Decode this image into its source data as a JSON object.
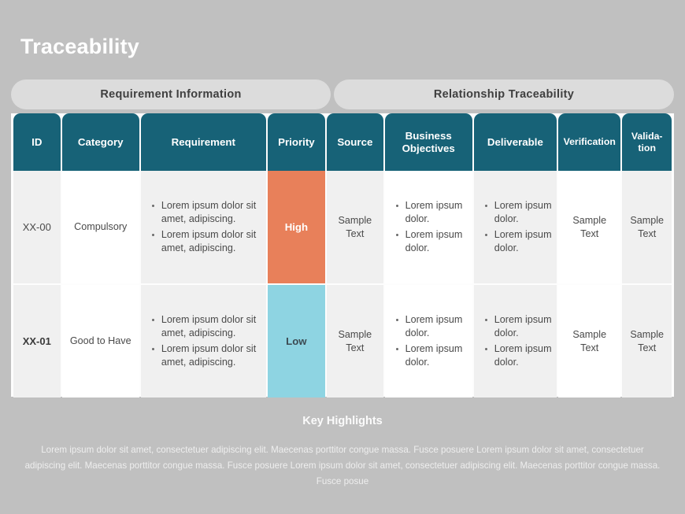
{
  "slide": {
    "title": "Traceability",
    "background_color": "#c0c0c0",
    "header_color": "#176277",
    "high_color": "#e8805a",
    "low_color": "#8ed4e2"
  },
  "banners": {
    "left": "Requirement Information",
    "right": "Relationship Traceability"
  },
  "table": {
    "columns": [
      {
        "key": "id",
        "label": "ID"
      },
      {
        "key": "category",
        "label": "Category"
      },
      {
        "key": "requirement",
        "label": "Requirement"
      },
      {
        "key": "priority",
        "label": "Priority"
      },
      {
        "key": "source",
        "label": "Source"
      },
      {
        "key": "business_objectives",
        "label": "Business Objectives"
      },
      {
        "key": "deliverable",
        "label": "Deliverable"
      },
      {
        "key": "verification",
        "label": "Verification"
      },
      {
        "key": "validation",
        "label": "Valida-\ntion"
      }
    ],
    "rows": [
      {
        "id": "XX-00",
        "category": "Compulsory",
        "requirement": [
          "Lorem ipsum dolor sit amet, adipiscing.",
          "Lorem ipsum dolor sit amet, adipiscing."
        ],
        "priority": "High",
        "source": "Sample Text",
        "business_objectives": [
          "Lorem ipsum dolor.",
          "Lorem ipsum dolor."
        ],
        "deliverable": [
          "Lorem ipsum dolor.",
          "Lorem ipsum dolor."
        ],
        "verification": "Sample Text",
        "validation": "Sample Text"
      },
      {
        "id": "XX-01",
        "category": "Good to Have",
        "requirement": [
          "Lorem ipsum dolor sit amet, adipiscing.",
          "Lorem ipsum dolor sit amet, adipiscing."
        ],
        "priority": "Low",
        "source": "Sample Text",
        "business_objectives": [
          "Lorem ipsum dolor.",
          "Lorem ipsum dolor."
        ],
        "deliverable": [
          "Lorem ipsum dolor.",
          "Lorem ipsum dolor."
        ],
        "verification": "Sample Text",
        "validation": "Sample Text"
      }
    ]
  },
  "key_highlights": {
    "title": "Key Highlights",
    "body": "Lorem ipsum dolor sit amet, consectetuer adipiscing elit. Maecenas porttitor congue massa. Fusce posuere Lorem ipsum dolor sit amet, consectetuer adipiscing elit. Maecenas porttitor congue massa. Fusce posuere Lorem ipsum dolor sit amet, consectetuer adipiscing elit. Maecenas porttitor congue massa. Fusce posue"
  }
}
